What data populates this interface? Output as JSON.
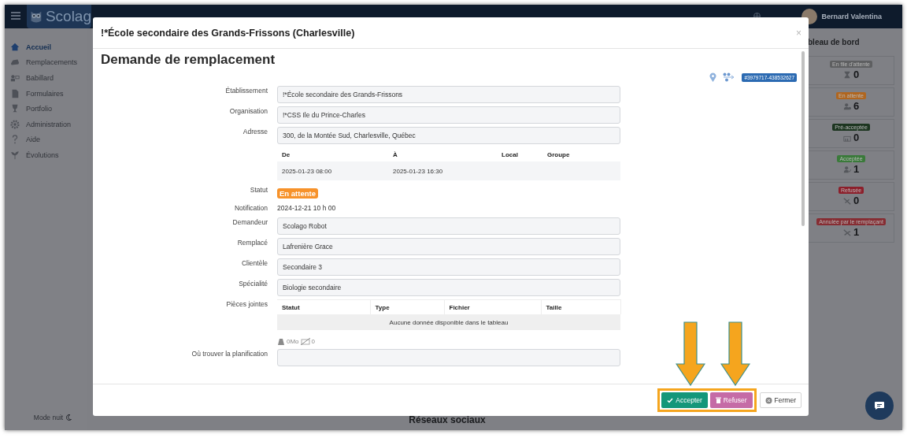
{
  "topbar": {
    "logo": "Scolag",
    "user": "Bernard Valentina"
  },
  "sidebar": {
    "items": [
      {
        "label": "Accueil",
        "selected": true
      },
      {
        "label": "Remplacements",
        "selected": false
      },
      {
        "label": "Babillard",
        "selected": false
      },
      {
        "label": "Formulaires",
        "selected": false
      },
      {
        "label": "Portfolio",
        "selected": false
      },
      {
        "label": "Administration",
        "selected": false
      },
      {
        "label": "Aide",
        "selected": false
      },
      {
        "label": "Évolutions",
        "selected": false
      }
    ],
    "night_mode": "Mode nuit"
  },
  "main": {
    "section_title": "Réseaux sociaux"
  },
  "dashboard": {
    "title": "bleau de bord",
    "cards": [
      {
        "label": "En file d'attente",
        "count": "0",
        "color": "#5e5f61"
      },
      {
        "label": "En attente",
        "count": "6",
        "color": "#b0661f"
      },
      {
        "label": "Pré-acceptée",
        "count": "0",
        "color": "#1c3520"
      },
      {
        "label": "Acceptée",
        "count": "1",
        "color": "#3a7a3a"
      },
      {
        "label": "Refusée",
        "count": "0",
        "color": "#8c1f2b"
      },
      {
        "label": "Annulée par le remplaçant",
        "count": "1",
        "color": "#862d33"
      }
    ]
  },
  "modal": {
    "title": "!*École secondaire des Grands-Frissons (Charlesville)",
    "close": "×",
    "heading": "Demande de remplacement",
    "reference": "#3979717-438532627",
    "rows": [
      {
        "kind": "field",
        "label": "Établissement",
        "value": "!*École secondaire des Grands-Frissons"
      },
      {
        "kind": "field",
        "label": "Organisation",
        "value": "!*CSS Ile du Prince-Charles"
      },
      {
        "kind": "field",
        "label": "Adresse",
        "value": "300, de la Montée Sud, Charlesville, Québec"
      },
      {
        "kind": "schedule",
        "columns": [
          "De",
          "À",
          "Local",
          "Groupe"
        ],
        "rows": [
          [
            "2025-01-23 08:00",
            "2025-01-23 16:30"
          ]
        ]
      },
      {
        "kind": "status",
        "label": "Statut",
        "value": "En attente"
      },
      {
        "kind": "text",
        "label": "Notification",
        "value": "2024-12-21 10 h 00"
      },
      {
        "kind": "field",
        "label": "Demandeur",
        "value": "Scolago Robot"
      },
      {
        "kind": "field",
        "label": "Remplacé",
        "value": "Lafrenière Grace"
      },
      {
        "kind": "field",
        "label": "Clientèle",
        "value": "Secondaire 3"
      },
      {
        "kind": "field",
        "label": "Spécialité",
        "value": "Biologie secondaire"
      },
      {
        "kind": "attachments",
        "label": "Pièces jointes",
        "columns": [
          "Statut",
          "Type",
          "Fichier",
          "Taille"
        ],
        "empty": "Aucune donnée disponible dans le tableau",
        "size": "0Mo",
        "count": "0"
      },
      {
        "kind": "field",
        "label": "Où trouver la planification"
      }
    ],
    "buttons": [
      {
        "kind": "accept",
        "label": "Accepter"
      },
      {
        "kind": "refuse",
        "label": "Refuser"
      },
      {
        "kind": "close",
        "label": "Fermer"
      }
    ]
  }
}
